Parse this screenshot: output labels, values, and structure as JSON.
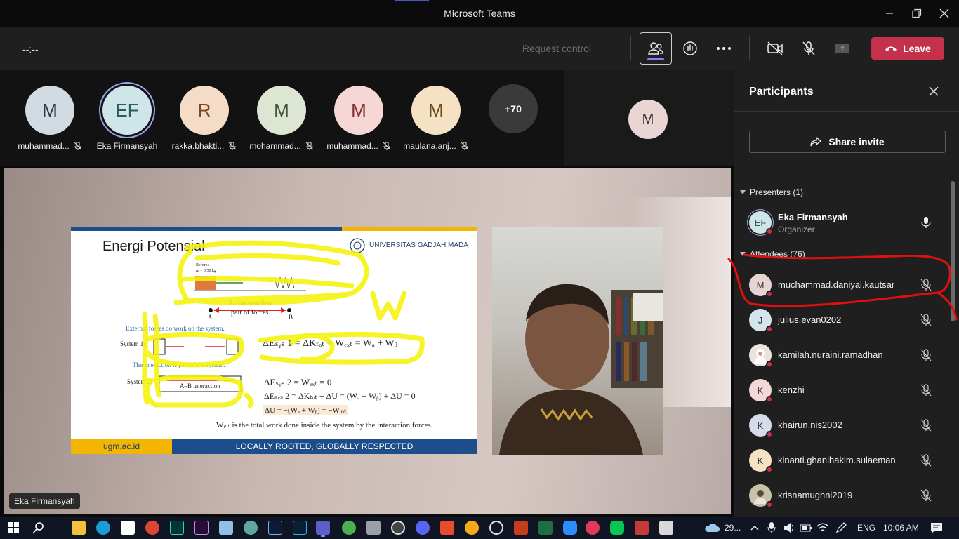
{
  "window": {
    "title": "Microsoft Teams"
  },
  "topbar": {
    "timer": "--:--",
    "request_control": "Request control",
    "leave_label": "Leave"
  },
  "strip": {
    "tiles": [
      {
        "initials": "M",
        "name": "muhammad...",
        "bg": "#d2dbe2",
        "fg": "#2f3a44"
      },
      {
        "initials": "EF",
        "name": "Eka Firmansyah",
        "bg": "#cfe6e8",
        "fg": "#2f5b5f"
      },
      {
        "initials": "R",
        "name": "rakka.bhakti...",
        "bg": "#f4dcc6",
        "fg": "#7a4a22"
      },
      {
        "initials": "M",
        "name": "mohammad...",
        "bg": "#dde6d3",
        "fg": "#3f5230"
      },
      {
        "initials": "M",
        "name": "muhammad...",
        "bg": "#f7d6d6",
        "fg": "#7c2f2f"
      },
      {
        "initials": "M",
        "name": "maulana.anj...",
        "bg": "#f5e2c5",
        "fg": "#6d4b18"
      }
    ],
    "more_count": "+70",
    "self_initial": "M"
  },
  "stage": {
    "slide": {
      "title": "Energi Potensial",
      "university": "UNIVERSITAS GADJAH MADA",
      "footer_left": "ugm.ac.id",
      "footer_right": "LOCALLY ROOTED, GLOBALLY RESPECTED",
      "action_reaction": "Action/reaction",
      "pair_of_forces": "pair of forces",
      "label_a": "A",
      "label_b": "B",
      "external_forces": "External forces do work on the system.",
      "interaction_part": "The interaction is part of the system.",
      "system1": "System 1:",
      "system2": "System 2:",
      "ab_interaction": "A–B interaction",
      "eq1": "ΔEₛᵧₛ 1 = ΔKₜₒₜ = Wₑₓₜ = Wₐ + Wᵦ",
      "eq2": "ΔEₛᵧₛ 2 = Wₑₓₜ = 0",
      "eq3": "ΔEₛᵧₛ 2 = ΔKₜₒₜ + ΔU = (Wₐ + Wᵦ) + ΔU = 0",
      "eq4": "ΔU = −(Wₐ + Wᵦ) = −Wᵢₙₜ",
      "wint_note": "Wᵢₙₜ is the total work done inside the system by the interaction forces.",
      "before": "Before:",
      "mass": "m = 0.50 kg"
    },
    "presenter_label": "Eka Firmansyah"
  },
  "panel": {
    "title": "Participants",
    "share_invite": "Share invite",
    "presenters_header": "Presenters (1)",
    "attendees_header": "Attendees (76)",
    "presenter": {
      "initials": "EF",
      "name": "Eka Firmansyah",
      "role": "Organizer"
    },
    "attendees": [
      {
        "initial": "M",
        "name": "muchammad.daniyal.kautsar",
        "bg": "#e6d4d2"
      },
      {
        "initial": "J",
        "name": "julius.evan0202",
        "bg": "#d3e4ef"
      },
      {
        "initial": "",
        "name": "kamilah.nuraini.ramadhan",
        "bg": "#e9e2df"
      },
      {
        "initial": "K",
        "name": "kenzhi",
        "bg": "#f2d8d8"
      },
      {
        "initial": "K",
        "name": "khairun.nis2002",
        "bg": "#d4dcea"
      },
      {
        "initial": "K",
        "name": "kinanti.ghanihakim.sulaeman",
        "bg": "#f5e3c3"
      },
      {
        "initial": "",
        "name": "krisnamughni2019",
        "bg": "#c7c2a9"
      }
    ]
  },
  "taskbar": {
    "weather": "29...",
    "language": "ENG",
    "time": "10:06 AM"
  },
  "colors": {
    "accent": "#7f85f5",
    "leave": "#c4314b",
    "annotation_red": "#e01010",
    "highlight": "#f5f20a"
  }
}
